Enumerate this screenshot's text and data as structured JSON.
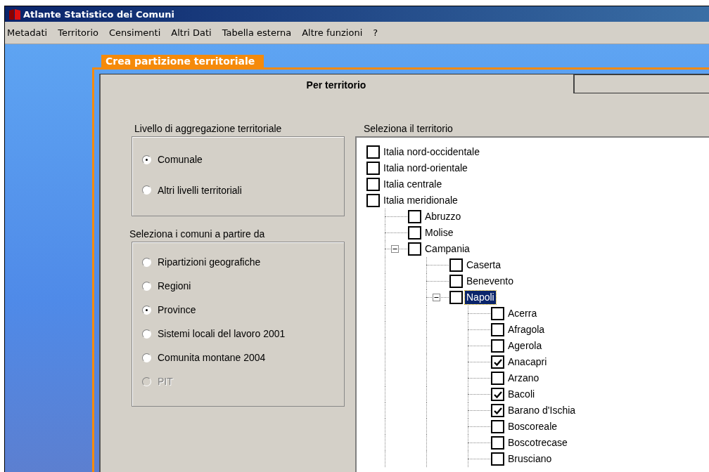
{
  "window": {
    "title": "Atlante Statistico dei Comuni"
  },
  "menu": [
    "Metadati",
    "Territorio",
    "Censimenti",
    "Altri Dati",
    "Tabella esterna",
    "Altre funzioni",
    "?"
  ],
  "panel": {
    "title": "Crea partizione territoriale"
  },
  "tabs": [
    {
      "label": "Per territorio",
      "selected": true
    },
    {
      "selected": false
    }
  ],
  "aggregation": {
    "label": "Livello di aggregazione territoriale",
    "options": [
      {
        "label": "Comunale",
        "selected": true,
        "disabled": false
      },
      {
        "label": "Altri livelli territoriali",
        "selected": false,
        "disabled": false
      }
    ]
  },
  "source": {
    "label": "Seleziona i comuni a partire da",
    "options": [
      {
        "label": "Ripartizioni geografiche",
        "selected": false,
        "disabled": false
      },
      {
        "label": "Regioni",
        "selected": false,
        "disabled": false
      },
      {
        "label": "Province",
        "selected": true,
        "disabled": false
      },
      {
        "label": "Sistemi locali del lavoro 2001",
        "selected": false,
        "disabled": false
      },
      {
        "label": "Comunita montane 2004",
        "selected": false,
        "disabled": false
      },
      {
        "label": "PIT",
        "selected": false,
        "disabled": true
      }
    ]
  },
  "territory": {
    "label": "Seleziona il territorio",
    "tree": [
      {
        "label": "Italia nord-occidentale",
        "checked": false,
        "selected": false
      },
      {
        "label": "Italia nord-orientale",
        "checked": false,
        "selected": false
      },
      {
        "label": "Italia centrale",
        "checked": false,
        "selected": false
      },
      {
        "label": "Italia meridionale",
        "checked": false,
        "selected": false,
        "children": [
          {
            "label": "Abruzzo",
            "checked": false,
            "selected": false
          },
          {
            "label": "Molise",
            "checked": false,
            "selected": false
          },
          {
            "label": "Campania",
            "checked": false,
            "selected": false,
            "expanded": true,
            "children": [
              {
                "label": "Caserta",
                "checked": false,
                "selected": false
              },
              {
                "label": "Benevento",
                "checked": false,
                "selected": false
              },
              {
                "label": "Napoli",
                "checked": false,
                "selected": true,
                "expanded": true,
                "children": [
                  {
                    "label": "Acerra",
                    "checked": false,
                    "selected": false
                  },
                  {
                    "label": "Afragola",
                    "checked": false,
                    "selected": false
                  },
                  {
                    "label": "Agerola",
                    "checked": false,
                    "selected": false
                  },
                  {
                    "label": "Anacapri",
                    "checked": true,
                    "selected": false
                  },
                  {
                    "label": "Arzano",
                    "checked": false,
                    "selected": false
                  },
                  {
                    "label": "Bacoli",
                    "checked": true,
                    "selected": false
                  },
                  {
                    "label": "Barano d'Ischia",
                    "checked": true,
                    "selected": false
                  },
                  {
                    "label": "Boscoreale",
                    "checked": false,
                    "selected": false
                  },
                  {
                    "label": "Boscotrecase",
                    "checked": false,
                    "selected": false
                  },
                  {
                    "label": "Brusciano",
                    "checked": false,
                    "selected": false
                  }
                ]
              }
            ]
          }
        ]
      }
    ]
  }
}
